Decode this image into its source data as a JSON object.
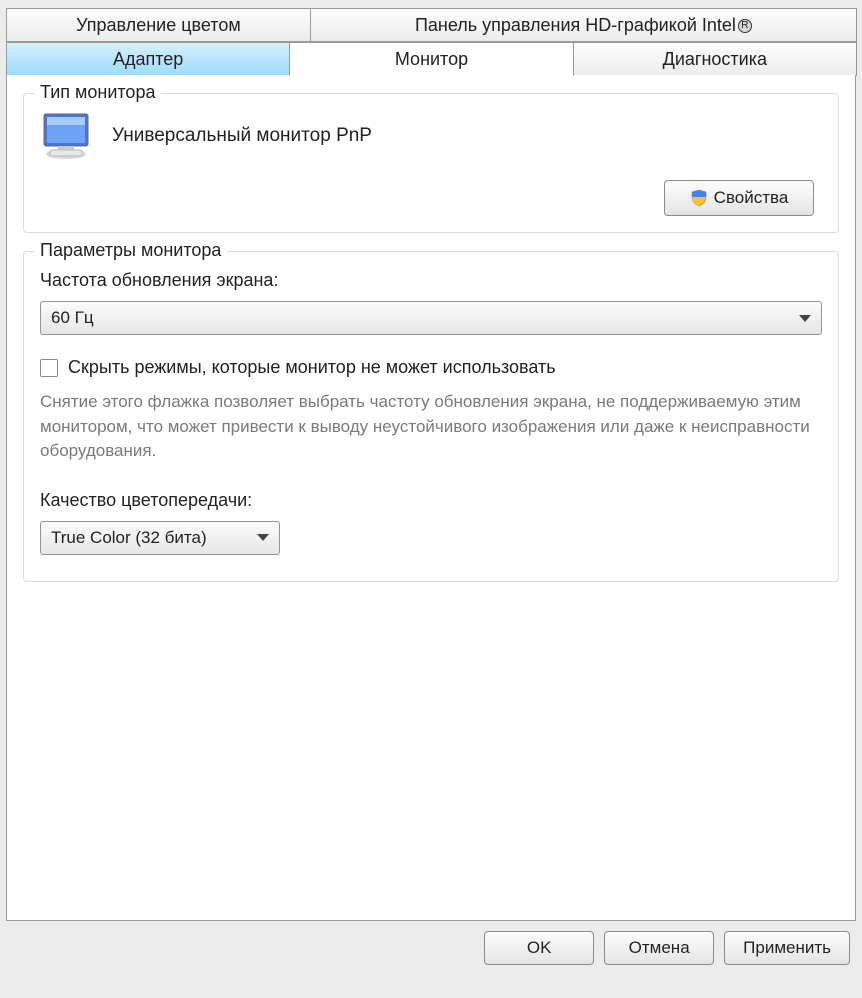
{
  "tabs": {
    "top": [
      {
        "label": "Управление цветом"
      },
      {
        "label": "Панель управления HD-графикой Intel"
      }
    ],
    "bottom": [
      {
        "label": "Адаптер"
      },
      {
        "label": "Монитор",
        "active": true
      },
      {
        "label": "Диагностика"
      }
    ]
  },
  "monitor_type": {
    "group_title": "Тип монитора",
    "name": "Универсальный монитор PnP",
    "properties_button": "Свойства"
  },
  "monitor_settings": {
    "group_title": "Параметры монитора",
    "refresh_label": "Частота обновления экрана:",
    "refresh_value": "60 Гц",
    "hide_modes_checkbox": "Скрыть режимы, которые монитор не может использовать",
    "hide_modes_hint": "Снятие этого флажка позволяет выбрать частоту обновления экрана, не поддерживаемую этим монитором, что может привести к выводу неустойчивого изображения или даже к неисправности оборудования.",
    "color_quality_label": "Качество цветопередачи:",
    "color_quality_value": "True Color (32 бита)"
  },
  "buttons": {
    "ok": "OK",
    "cancel": "Отмена",
    "apply": "Применить"
  }
}
